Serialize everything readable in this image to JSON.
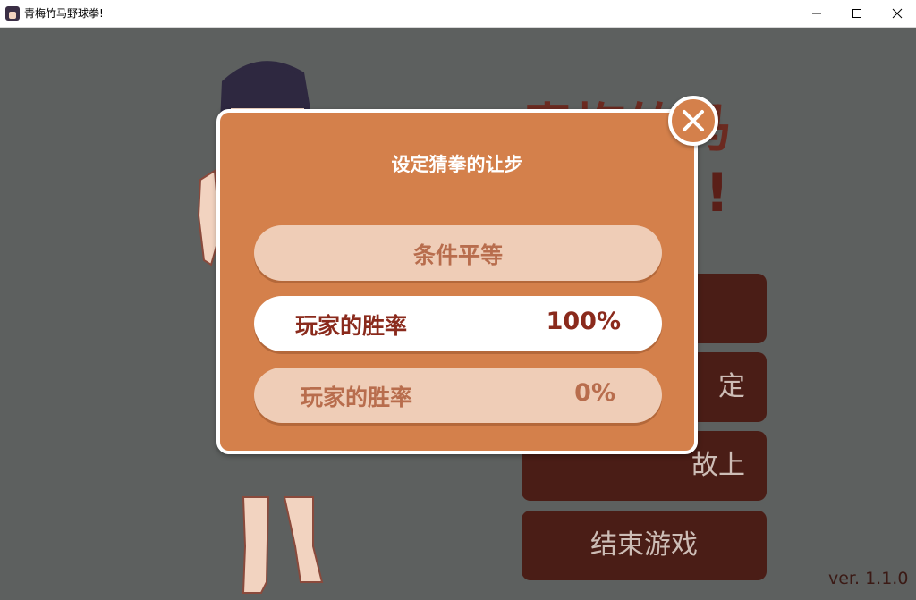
{
  "window": {
    "title": "青梅竹马野球拳!",
    "icon": "app-icon",
    "controls": [
      "minimize-icon",
      "maximize-icon",
      "close-icon"
    ]
  },
  "background": {
    "title_line1": "青梅竹马",
    "title_line2": "!",
    "menu": {
      "button1": "",
      "button2_partial": "定",
      "button3_partial": "故上",
      "button4": "结束游戏"
    },
    "version": "ver. 1.1.0"
  },
  "dialog": {
    "title": "设定猜拳的让步",
    "options": [
      {
        "label": "条件平等"
      },
      {
        "label": "玩家的胜率",
        "value": "100%"
      },
      {
        "label": "玩家的胜率",
        "value": "0%"
      }
    ],
    "close_icon": "close-x-icon"
  },
  "colors": {
    "dialog_bg": "#d4804b",
    "option_bg": "#efcdb7",
    "option_selected_bg": "#ffffff",
    "menu_button_bg": "#4a1d16",
    "game_bg": "#5d605f"
  }
}
